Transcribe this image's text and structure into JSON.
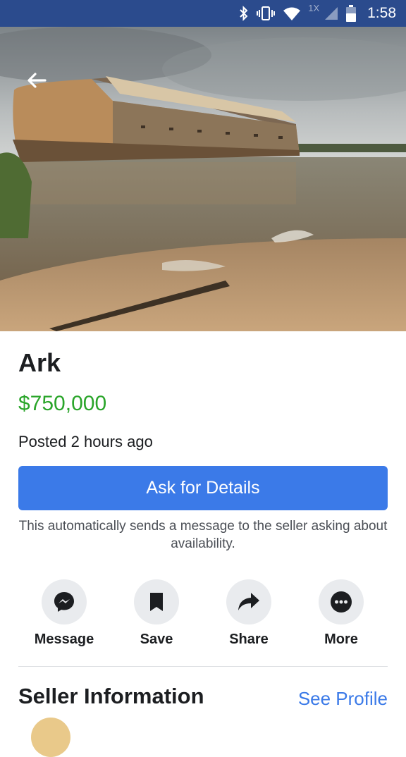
{
  "status_bar": {
    "time": "1:58",
    "network_label": "1X"
  },
  "listing": {
    "title": "Ark",
    "price": "$750,000",
    "posted": "Posted 2 hours ago",
    "image_alt": "Ark replica on a riverbank"
  },
  "cta": {
    "ask_label": "Ask for Details",
    "helper_text": "This automatically sends a message to the seller asking about availability."
  },
  "actions": [
    {
      "label": "Message",
      "icon": "messenger-icon"
    },
    {
      "label": "Save",
      "icon": "bookmark-icon"
    },
    {
      "label": "Share",
      "icon": "share-arrow-icon"
    },
    {
      "label": "More",
      "icon": "more-dots-icon"
    }
  ],
  "seller": {
    "heading": "Seller Information",
    "see_profile": "See Profile"
  },
  "colors": {
    "brand_blue": "#3b7ae8",
    "status_bar": "#2b4b8d",
    "price_green": "#2aa52a"
  }
}
